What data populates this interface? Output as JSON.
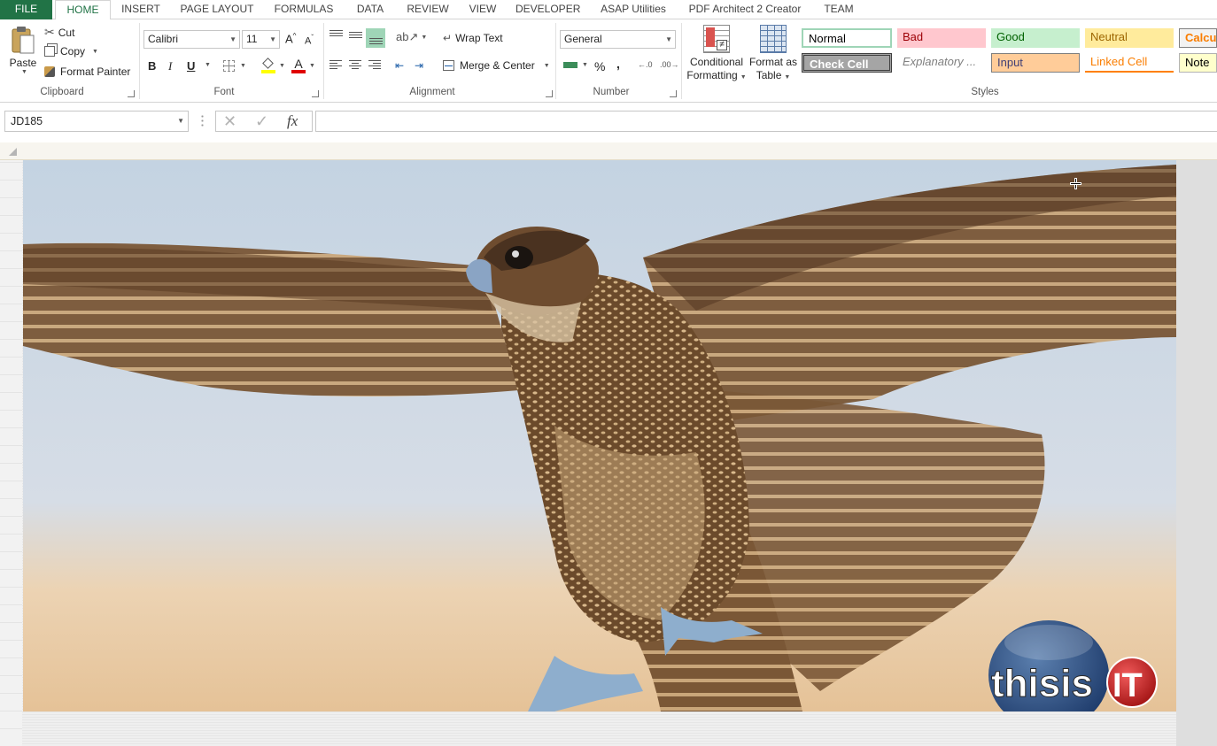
{
  "tabs": [
    "FILE",
    "HOME",
    "INSERT",
    "PAGE LAYOUT",
    "FORMULAS",
    "DATA",
    "REVIEW",
    "VIEW",
    "DEVELOPER",
    "ASAP Utilities",
    "PDF Architect 2 Creator",
    "TEAM"
  ],
  "clipboard": {
    "paste": "Paste",
    "cut": "Cut",
    "copy": "Copy",
    "format_painter": "Format Painter",
    "group": "Clipboard"
  },
  "font": {
    "name": "Calibri",
    "size": "11",
    "bold": "B",
    "italic": "I",
    "underline": "U",
    "group": "Font"
  },
  "alignment": {
    "wrap": "Wrap Text",
    "merge": "Merge & Center",
    "group": "Alignment"
  },
  "number": {
    "format": "General",
    "percent": "%",
    "comma": ",",
    "group": "Number"
  },
  "cond_format": {
    "line1": "Conditional",
    "line2": "Formatting"
  },
  "format_table": {
    "line1": "Format as",
    "line2": "Table"
  },
  "styles": {
    "group": "Styles",
    "normal": "Normal",
    "bad": "Bad",
    "good": "Good",
    "neutral": "Neutral",
    "calc": "Calcula",
    "check": "Check Cell",
    "explanatory": "Explanatory ...",
    "input": "Input",
    "linked": "Linked Cell",
    "note": "Note"
  },
  "formula_bar": {
    "name_box": "JD185",
    "fx": "fx"
  },
  "logo": {
    "text_a": "thisis",
    "text_b": "IT"
  },
  "colors": {
    "accent": "#217346",
    "good_bg": "#c6efce",
    "bad_bg": "#ffc7ce",
    "neutral_bg": "#ffeb9c",
    "input_bg": "#ffcc99",
    "check_bg": "#a5a5a5",
    "sky": "#c9d6e3",
    "sand": "#e8c9a0"
  }
}
